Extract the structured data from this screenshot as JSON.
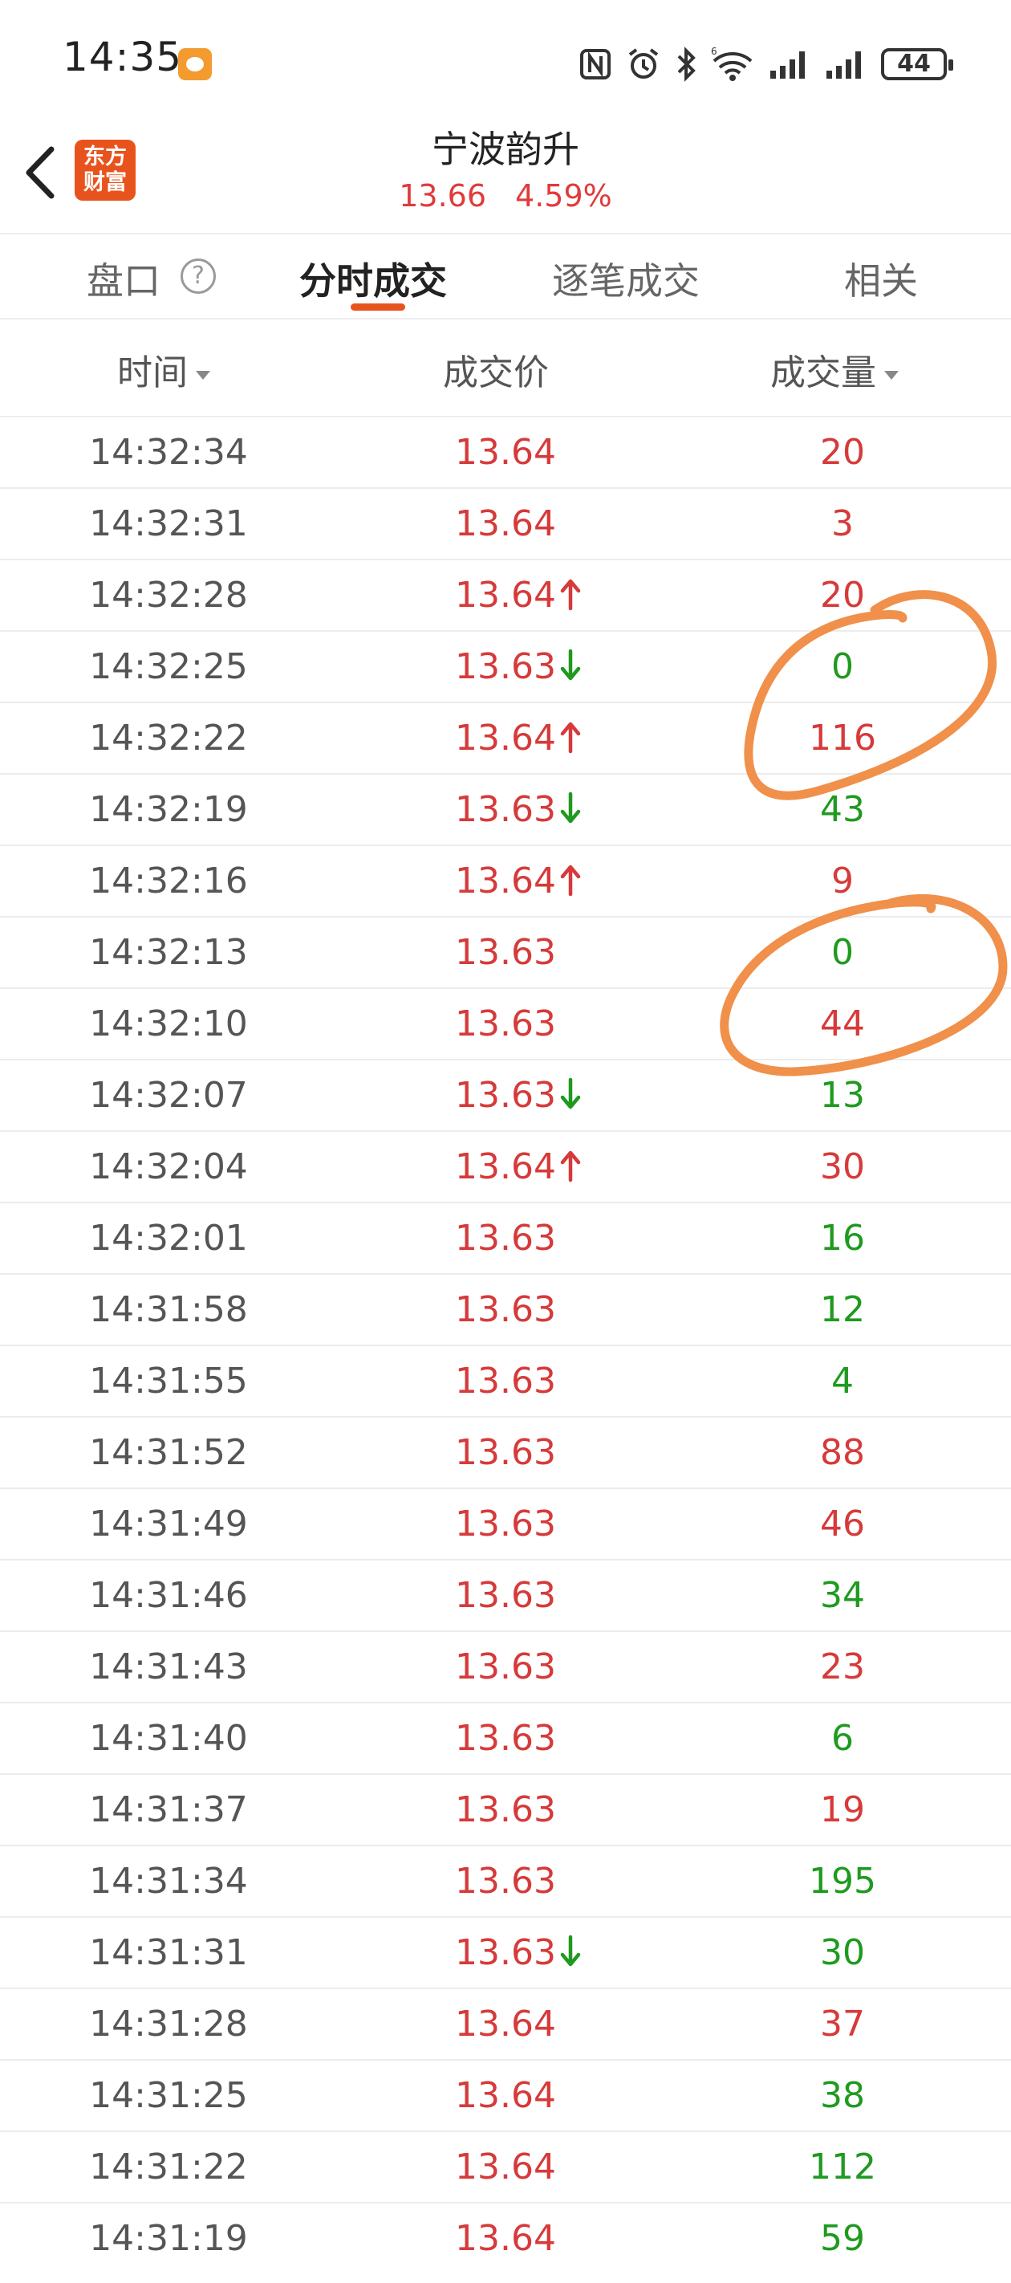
{
  "status_bar": {
    "time": "14:35",
    "battery": "44"
  },
  "header": {
    "logo_line1": "东方",
    "logo_line2": "财富",
    "stock_name": "宁波韵升",
    "price": "13.66",
    "change_pct": "4.59%"
  },
  "tabs": [
    {
      "label": "盘口"
    },
    {
      "label": "分时成交"
    },
    {
      "label": "逐笔成交"
    },
    {
      "label": "相关"
    }
  ],
  "columns": {
    "time": "时间",
    "price": "成交价",
    "volume": "成交量"
  },
  "colors": {
    "up": "#d63a3a",
    "down": "#1f9a1f",
    "accent": "#e8531d",
    "annotation": "#f0904a"
  },
  "trades": [
    {
      "time": "14:32:34",
      "price": "13.64",
      "arrow": "",
      "volume": "20",
      "dir": "up"
    },
    {
      "time": "14:32:31",
      "price": "13.64",
      "arrow": "",
      "volume": "3",
      "dir": "up"
    },
    {
      "time": "14:32:28",
      "price": "13.64",
      "arrow": "up",
      "volume": "20",
      "dir": "up"
    },
    {
      "time": "14:32:25",
      "price": "13.63",
      "arrow": "down",
      "volume": "0",
      "dir": "down"
    },
    {
      "time": "14:32:22",
      "price": "13.64",
      "arrow": "up",
      "volume": "116",
      "dir": "up"
    },
    {
      "time": "14:32:19",
      "price": "13.63",
      "arrow": "down",
      "volume": "43",
      "dir": "down"
    },
    {
      "time": "14:32:16",
      "price": "13.64",
      "arrow": "up",
      "volume": "9",
      "dir": "up"
    },
    {
      "time": "14:32:13",
      "price": "13.63",
      "arrow": "",
      "volume": "0",
      "dir": "down"
    },
    {
      "time": "14:32:10",
      "price": "13.63",
      "arrow": "",
      "volume": "44",
      "dir": "up"
    },
    {
      "time": "14:32:07",
      "price": "13.63",
      "arrow": "down",
      "volume": "13",
      "dir": "down"
    },
    {
      "time": "14:32:04",
      "price": "13.64",
      "arrow": "up",
      "volume": "30",
      "dir": "up"
    },
    {
      "time": "14:32:01",
      "price": "13.63",
      "arrow": "",
      "volume": "16",
      "dir": "down"
    },
    {
      "time": "14:31:58",
      "price": "13.63",
      "arrow": "",
      "volume": "12",
      "dir": "down"
    },
    {
      "time": "14:31:55",
      "price": "13.63",
      "arrow": "",
      "volume": "4",
      "dir": "down"
    },
    {
      "time": "14:31:52",
      "price": "13.63",
      "arrow": "",
      "volume": "88",
      "dir": "up"
    },
    {
      "time": "14:31:49",
      "price": "13.63",
      "arrow": "",
      "volume": "46",
      "dir": "up"
    },
    {
      "time": "14:31:46",
      "price": "13.63",
      "arrow": "",
      "volume": "34",
      "dir": "down"
    },
    {
      "time": "14:31:43",
      "price": "13.63",
      "arrow": "",
      "volume": "23",
      "dir": "up"
    },
    {
      "time": "14:31:40",
      "price": "13.63",
      "arrow": "",
      "volume": "6",
      "dir": "down"
    },
    {
      "time": "14:31:37",
      "price": "13.63",
      "arrow": "",
      "volume": "19",
      "dir": "up"
    },
    {
      "time": "14:31:34",
      "price": "13.63",
      "arrow": "",
      "volume": "195",
      "dir": "down"
    },
    {
      "time": "14:31:31",
      "price": "13.63",
      "arrow": "down",
      "volume": "30",
      "dir": "down"
    },
    {
      "time": "14:31:28",
      "price": "13.64",
      "arrow": "",
      "volume": "37",
      "dir": "up"
    },
    {
      "time": "14:31:25",
      "price": "13.64",
      "arrow": "",
      "volume": "38",
      "dir": "down"
    },
    {
      "time": "14:31:22",
      "price": "13.64",
      "arrow": "",
      "volume": "112",
      "dir": "down"
    },
    {
      "time": "14:31:19",
      "price": "13.64",
      "arrow": "",
      "volume": "59",
      "dir": "down"
    }
  ]
}
